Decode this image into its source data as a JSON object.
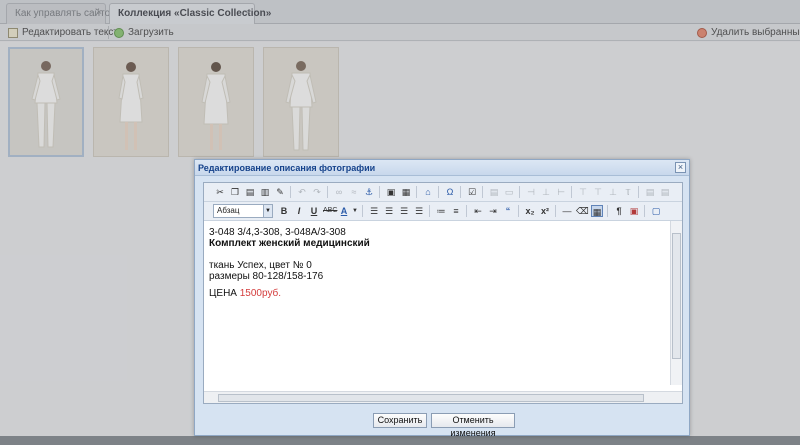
{
  "tabs": [
    {
      "label": "Как управлять сайтом",
      "close": "×"
    },
    {
      "label": "Коллекция «Classic Collection»",
      "close": "×"
    }
  ],
  "toolbar": {
    "edit_text": "Редактировать текст",
    "upload": "Загрузить",
    "delete_selected": "Удалить выбранные"
  },
  "gallery": {
    "photos_count": 4
  },
  "dialog": {
    "title": "Редактирование описания фотографии",
    "close": "×",
    "format_select": "Абзац",
    "save": "Сохранить",
    "cancel": "Отменить изменения",
    "content": {
      "codes": "3-048 3/4,3-308, 3-048А/3-308",
      "name": "Комплект женский медицинский",
      "fabric": "ткань Успех, цвет № 0",
      "sizes": "размеры 80-128/158-176",
      "price_label": "ЦЕНА ",
      "price_value": "1500руб."
    }
  },
  "editor_toolbar": {
    "row1": [
      "cut-icon",
      "copy-icon",
      "paste-icon",
      "paste-text-icon",
      "paste-word-icon",
      "clean-icon",
      "undo-icon",
      "redo-icon",
      "link-icon",
      "unlink-icon",
      "anchor-icon",
      "image-icon",
      "flash-icon",
      "home-icon",
      "special-char-icon",
      "source-icon",
      "table-icon",
      "row-icon",
      "col-icon",
      "cell-icon",
      "merge-icon",
      "split-icon"
    ],
    "row2": [
      "bold-icon",
      "italic-icon",
      "underline-icon",
      "strike-icon",
      "font-color-icon",
      "align-left-icon",
      "align-center-icon",
      "align-right-icon",
      "justify-icon",
      "bullet-list-icon",
      "numbered-list-icon",
      "outdent-icon",
      "indent-icon",
      "blockquote-icon",
      "subscript-icon",
      "superscript-icon",
      "hr-icon",
      "remove-format-icon",
      "visual-aid-icon",
      "paragraph-icon",
      "fullscreen-icon",
      "preview-icon"
    ]
  },
  "colors": {
    "price": "#d43c3c",
    "dialog_title": "#15428b",
    "dialog_bg": "#d6e3f2"
  }
}
